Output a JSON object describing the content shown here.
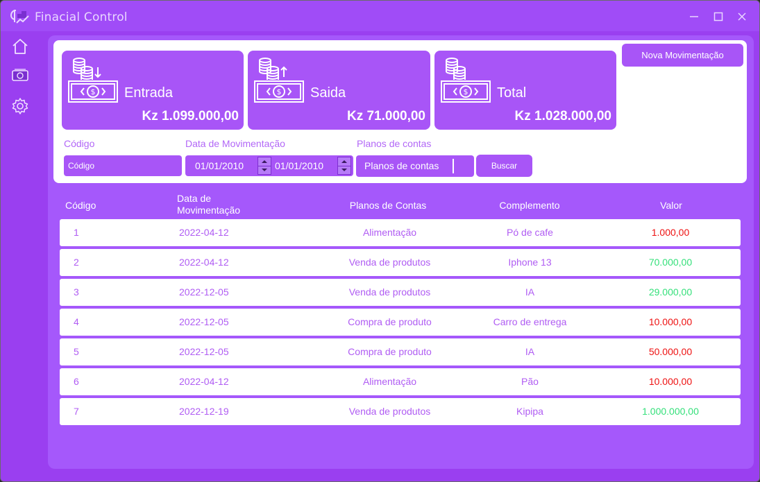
{
  "window": {
    "title": "Finacial Control"
  },
  "sidebar": {
    "items": [
      {
        "icon": "home-icon"
      },
      {
        "icon": "money-icon"
      },
      {
        "icon": "gear-icon"
      }
    ]
  },
  "cards": {
    "entrada": {
      "label": "Entrada",
      "value": "Kz 1.099.000,00",
      "icon": "cash-in-icon"
    },
    "saida": {
      "label": "Saida",
      "value": "Kz 71.000,00",
      "icon": "cash-out-icon"
    },
    "total": {
      "label": "Total",
      "value": "Kz 1.028.000,00",
      "icon": "cash-total-icon"
    }
  },
  "actions": {
    "nova_label": "Nova Movimentação",
    "buscar_label": "Buscar"
  },
  "filters": {
    "codigo_label": "Código",
    "codigo_placeholder": "Código",
    "data_label": "Data de Movimentação",
    "data_from": "01/01/2010",
    "data_to": "01/01/2010",
    "planos_label": "Planos de contas",
    "planos_value": "Planos de contas"
  },
  "table": {
    "headers": {
      "codigo": "Código",
      "data": "Data de Movimentação",
      "planos": "Planos de Contas",
      "complemento": "Complemento",
      "valor": "Valor"
    },
    "rows": [
      {
        "codigo": "1",
        "data": "2022-04-12",
        "planos": "Alimentação",
        "complemento": "Pó de cafe",
        "valor": "1.000,00",
        "tipo": "saida"
      },
      {
        "codigo": "2",
        "data": "2022-04-12",
        "planos": "Venda de produtos",
        "complemento": "Iphone 13",
        "valor": "70.000,00",
        "tipo": "entrada"
      },
      {
        "codigo": "3",
        "data": "2022-12-05",
        "planos": "Venda de produtos",
        "complemento": "IA",
        "valor": "29.000,00",
        "tipo": "entrada"
      },
      {
        "codigo": "4",
        "data": "2022-12-05",
        "planos": "Compra de produto",
        "complemento": "Carro de entrega",
        "valor": "10.000,00",
        "tipo": "saida"
      },
      {
        "codigo": "5",
        "data": "2022-12-05",
        "planos": "Compra de produto",
        "complemento": "IA",
        "valor": "50.000,00",
        "tipo": "saida"
      },
      {
        "codigo": "6",
        "data": "2022-04-12",
        "planos": "Alimentação",
        "complemento": "Pão",
        "valor": "10.000,00",
        "tipo": "saida"
      },
      {
        "codigo": "7",
        "data": "2022-12-19",
        "planos": "Venda de produtos",
        "complemento": "Kipipa",
        "valor": "1.000.000,00",
        "tipo": "entrada"
      }
    ]
  },
  "colors": {
    "accent": "#a855f7",
    "negative": "#ee1111",
    "positive": "#34e07a",
    "text": "#b05cf3"
  }
}
